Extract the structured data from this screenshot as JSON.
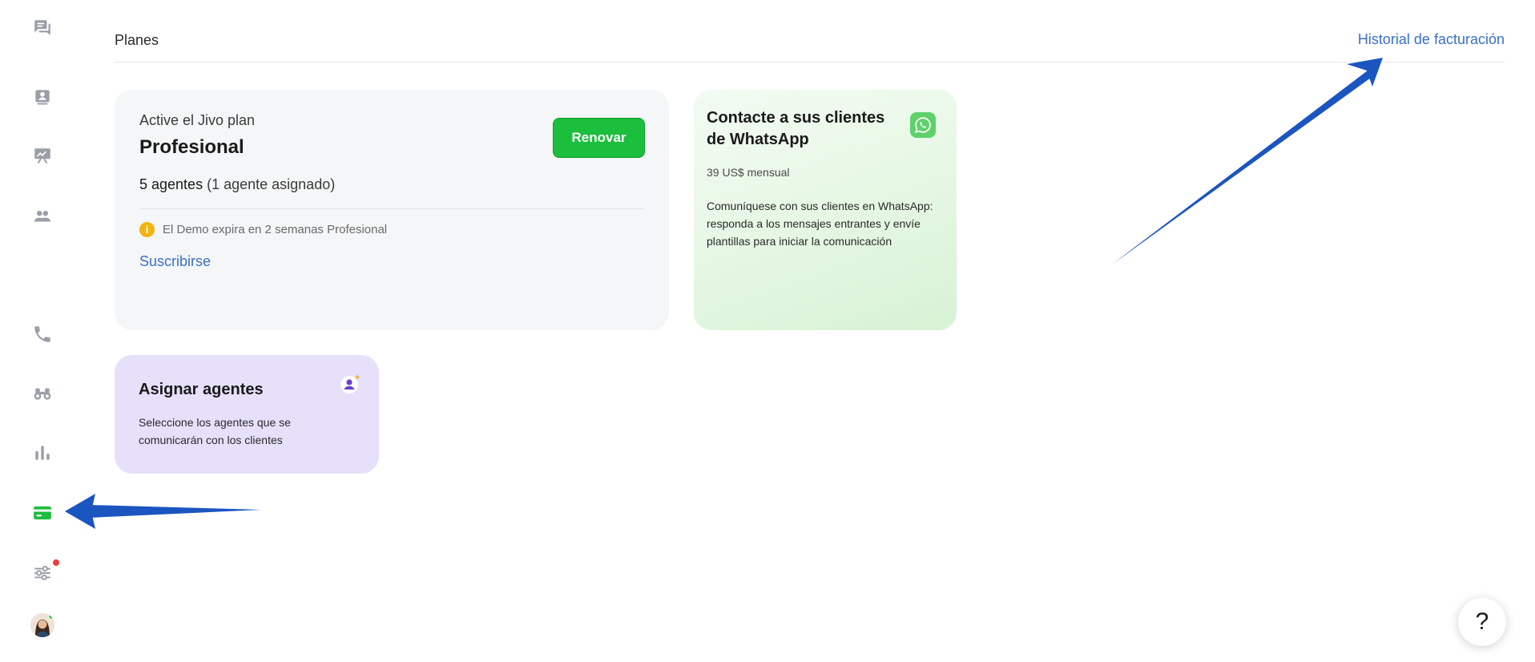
{
  "header": {
    "page_title": "Planes",
    "billing_link": "Historial de facturación"
  },
  "sidebar": {
    "items": [
      {
        "name": "chats-icon"
      },
      {
        "name": "contacts-icon"
      },
      {
        "name": "presentation-icon"
      },
      {
        "name": "team-icon"
      },
      {
        "name": "phone-icon"
      },
      {
        "name": "binoculars-icon"
      },
      {
        "name": "stats-icon"
      },
      {
        "name": "billing-card-icon",
        "active": true
      },
      {
        "name": "settings-sliders-icon",
        "badge": true
      }
    ],
    "active_color": "#1cbe3d"
  },
  "plan_card": {
    "subtitle": "Active el Jivo plan",
    "plan_name": "Profesional",
    "renew_label": "Renovar",
    "agents_count": "5 agentes",
    "agents_assigned": "(1 agente asignado)",
    "demo_text": "El Demo expira en 2 semanas Profesional",
    "subscribe_label": "Suscribirse"
  },
  "whatsapp_card": {
    "title": "Contacte a sus clientes de WhatsApp",
    "price": "39 US$ mensual",
    "description": "Comuníquese con sus clientes en WhatsApp: responda a los mensajes entrantes y envíe plantillas para iniciar la comunicación"
  },
  "assign_card": {
    "title": "Asignar agentes",
    "description": "Seleccione los agentes que se comunicarán con los clientes"
  },
  "help": {
    "label": "?"
  },
  "colors": {
    "accent_green": "#1cbe3d",
    "link_blue": "#3a6fc7",
    "arrow_blue": "#1b55c0"
  }
}
